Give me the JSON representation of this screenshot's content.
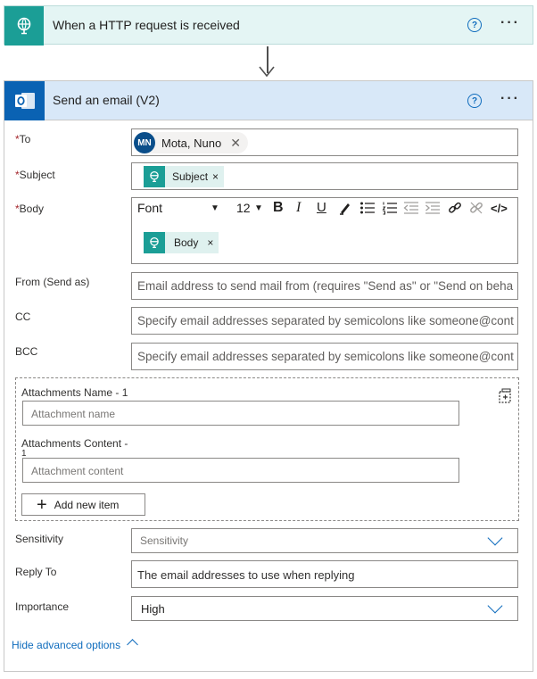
{
  "trigger": {
    "title": "When a HTTP request is received",
    "icon": "http-request-globe-icon",
    "accent": "#1b9e96"
  },
  "action": {
    "title": "Send an email (V2)",
    "icon": "outlook-icon",
    "accent": "#0a62b3"
  },
  "help_glyph": "?",
  "more_glyph": "···",
  "fields": {
    "to": {
      "label": "To",
      "required_mark": "*",
      "persona_initials": "MN",
      "persona_name": "Mota, Nuno",
      "remove": "✕"
    },
    "subject": {
      "label": "Subject",
      "required_mark": "*",
      "token": "Subject",
      "remove": "×"
    },
    "body": {
      "label": "Body",
      "required_mark": "*",
      "token": "Body",
      "remove": "×",
      "toolbar": {
        "font": "Font",
        "size": "12",
        "bold": "B",
        "italic": "I",
        "underline": "U",
        "code": "</>"
      }
    },
    "from": {
      "label": "From (Send as)",
      "placeholder": "Email address to send mail from (requires \"Send as\" or \"Send on beha"
    },
    "cc": {
      "label": "CC",
      "placeholder": "Specify email addresses separated by semicolons like someone@cont"
    },
    "bcc": {
      "label": "BCC",
      "placeholder": "Specify email addresses separated by semicolons like someone@cont"
    },
    "attachments": {
      "name_label": "Attachments Name - 1",
      "name_placeholder": "Attachment name",
      "content_label": "Attachments Content -",
      "content_label_wrap": "1",
      "content_placeholder": "Attachment content",
      "add_button": "Add new item"
    },
    "sensitivity": {
      "label": "Sensitivity",
      "placeholder": "Sensitivity"
    },
    "reply_to": {
      "label": "Reply To",
      "placeholder": "The email addresses to use when replying"
    },
    "importance": {
      "label": "Importance",
      "value": "High"
    }
  },
  "hide_advanced": "Hide advanced options",
  "colors": {
    "link": "#0f6cbd",
    "required": "#a4262c",
    "header_bg": "#d8e8f8",
    "trigger_bg": "#e4f5f4"
  }
}
